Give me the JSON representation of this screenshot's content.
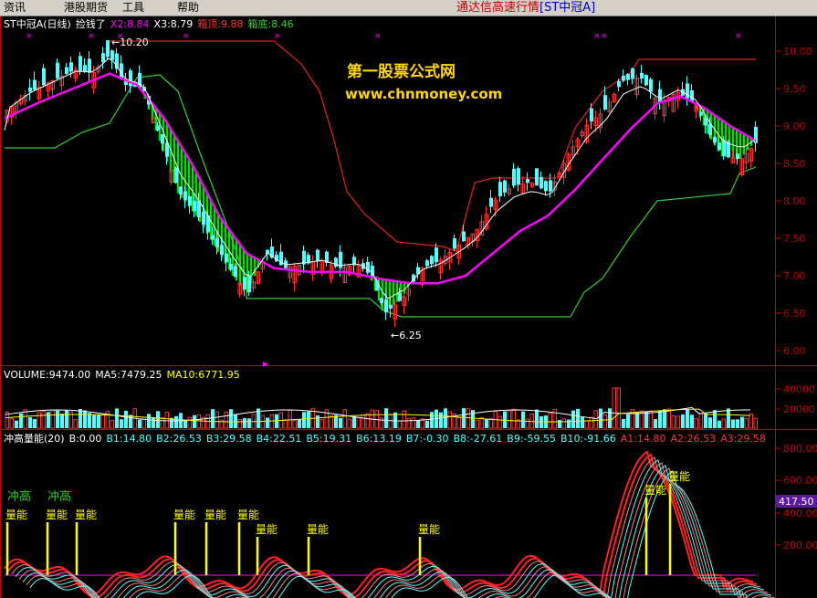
{
  "menu": {
    "items": [
      "资讯",
      "港股期货",
      "工具",
      "帮助"
    ],
    "app_title": "通达信高速行情",
    "stock_bracket": "[ST中冠A]"
  },
  "main": {
    "title": "ST中冠A(日线)",
    "indicator_name": "捡钱了",
    "x2": "X2:8.84",
    "x3": "X3:8.79",
    "box_top": "箱顶:9.88",
    "box_bottom": "箱底:8.46",
    "high_label": "10.20",
    "low_label": "6.25",
    "watermark_line1": "第一股票公式网",
    "watermark_line2": "www.chnmoney.com",
    "yaxis": [
      "10.00",
      "9.50",
      "9.00",
      "8.50",
      "8.00",
      "7.50",
      "7.00",
      "6.50",
      "6.00"
    ]
  },
  "volume": {
    "label": "VOLUME:9474.00",
    "ma5": "MA5:7479.25",
    "ma10": "MA10:6771.95",
    "yaxis": [
      "40000",
      "20000"
    ]
  },
  "energy": {
    "name": "冲高量能(20)",
    "values": [
      "B:0.00",
      "B1:14.80",
      "B2:26.53",
      "B3:29.58",
      "B4:22.51",
      "B5:19.31",
      "B6:13.19",
      "B7:-0.30",
      "B8:-27.61",
      "B9:-59.55",
      "B10:-91.66"
    ],
    "a_values": [
      "A1:14.80",
      "A2:26.53",
      "A3:29.58"
    ],
    "yaxis": [
      "800.00",
      "600.00",
      "400.00",
      "200.00"
    ],
    "current_value": "417.50",
    "surge_label": "冲高",
    "energy_label": "量能"
  },
  "colors": {
    "up": "#ff3232",
    "down": "#54ffff",
    "ma_main": "#ff00ff",
    "box": "#c00000",
    "green_box": "#32cd32",
    "fill": "#00e000",
    "axis": "#c00000",
    "yellow": "#ffff00"
  },
  "chart_data": {
    "type": "candlestick",
    "ylim": [
      5.8,
      10.4
    ],
    "series": [
      {
        "name": "X2",
        "values": [
          8.84
        ]
      },
      {
        "name": "X3",
        "values": [
          8.79
        ]
      }
    ],
    "annotations": [
      "10.20",
      "6.25"
    ]
  }
}
